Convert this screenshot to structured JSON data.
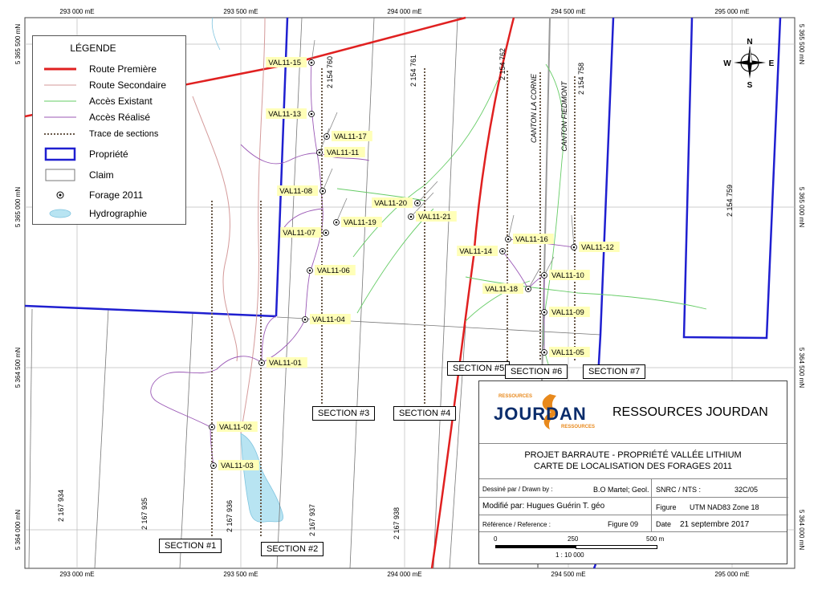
{
  "legend": {
    "title": "LÉGENDE",
    "items": [
      {
        "label": "Route Première",
        "color": "#e02020"
      },
      {
        "label": "Route Secondaire",
        "color": "#d49a9a"
      },
      {
        "label": "Accès Existant",
        "color": "#66cc66"
      },
      {
        "label": "Accès Réalisé",
        "color": "#9b59b6"
      },
      {
        "label": "Trace de sections",
        "color": "#666666"
      },
      {
        "label": "Propriété",
        "color": "#1f1fd0"
      },
      {
        "label": "Claim",
        "color": "#777777"
      },
      {
        "label": "Forage 2011",
        "color": "#000000"
      },
      {
        "label": "Hydrographie",
        "color": "#b8e4f2"
      }
    ]
  },
  "grid": {
    "eastings": [
      "293 000 mE",
      "293 500 mE",
      "294 000 mE",
      "294 500 mE",
      "295 000 mE"
    ],
    "northings_left": [
      "5 365 500 mN",
      "5 365 000 mN",
      "5 364 500 mN",
      "5 364 000 mN"
    ],
    "northings_right": [
      "5 365 500 mN",
      "5 365 000 mN",
      "5 364 500 mN",
      "5 364 000 mN"
    ]
  },
  "claims": [
    "2 154 760",
    "2 154 761",
    "2 154 762",
    "2 154 758",
    "2 154 759",
    "2 167 934",
    "2 167 935",
    "2 167 936",
    "2 167 937",
    "2 167 938"
  ],
  "cantons": [
    "CANTON LA CORNE",
    "CANTON FIEDMONT"
  ],
  "compass": {
    "n": "N",
    "s": "S",
    "e": "E",
    "w": "W"
  },
  "drillholes": [
    "VAL11-15",
    "VAL11-13",
    "VAL11-17",
    "VAL11-11",
    "VAL11-08",
    "VAL11-07",
    "VAL11-19",
    "VAL11-06",
    "VAL11-04",
    "VAL11-01",
    "VAL11-02",
    "VAL11-03",
    "VAL11-20",
    "VAL11-21",
    "VAL11-14",
    "VAL11-16",
    "VAL11-12",
    "VAL11-18",
    "VAL11-10",
    "VAL11-09",
    "VAL11-05"
  ],
  "sections": [
    "SECTION #1",
    "SECTION #2",
    "SECTION #3",
    "SECTION #4",
    "SECTION #5",
    "SECTION #6",
    "SECTION #7"
  ],
  "titleblock": {
    "company": "RESSOURCES JOURDAN",
    "logo_text": "JOURDAN",
    "logo_small_top": "RESSOURCES",
    "logo_small_bottom": "RESSOURCES",
    "project": "PROJET BARRAUTE - PROPRIÉTÉ VALLÉE LITHIUM",
    "map_title": "CARTE DE LOCALISATION DES FORAGES 2011",
    "drawn_label": "Dessiné par / Drawn by :",
    "drawn_value": "B.O Martel; Geol.",
    "modified": "Modifié par: Hugues Guérin T. géo",
    "reference_label": "Référence / Reference :",
    "figure": "Figure 09",
    "snrc_label": "SNRC / NTS :",
    "snrc_value": "32C/05",
    "figure_label": "Figure",
    "projection": "UTM NAD83 Zone 18",
    "date_label": "Date",
    "date_value": "21 septembre 2017",
    "scale_0": "0",
    "scale_250": "250",
    "scale_500": "500 m",
    "scale_ratio": "1 : 10 000"
  }
}
